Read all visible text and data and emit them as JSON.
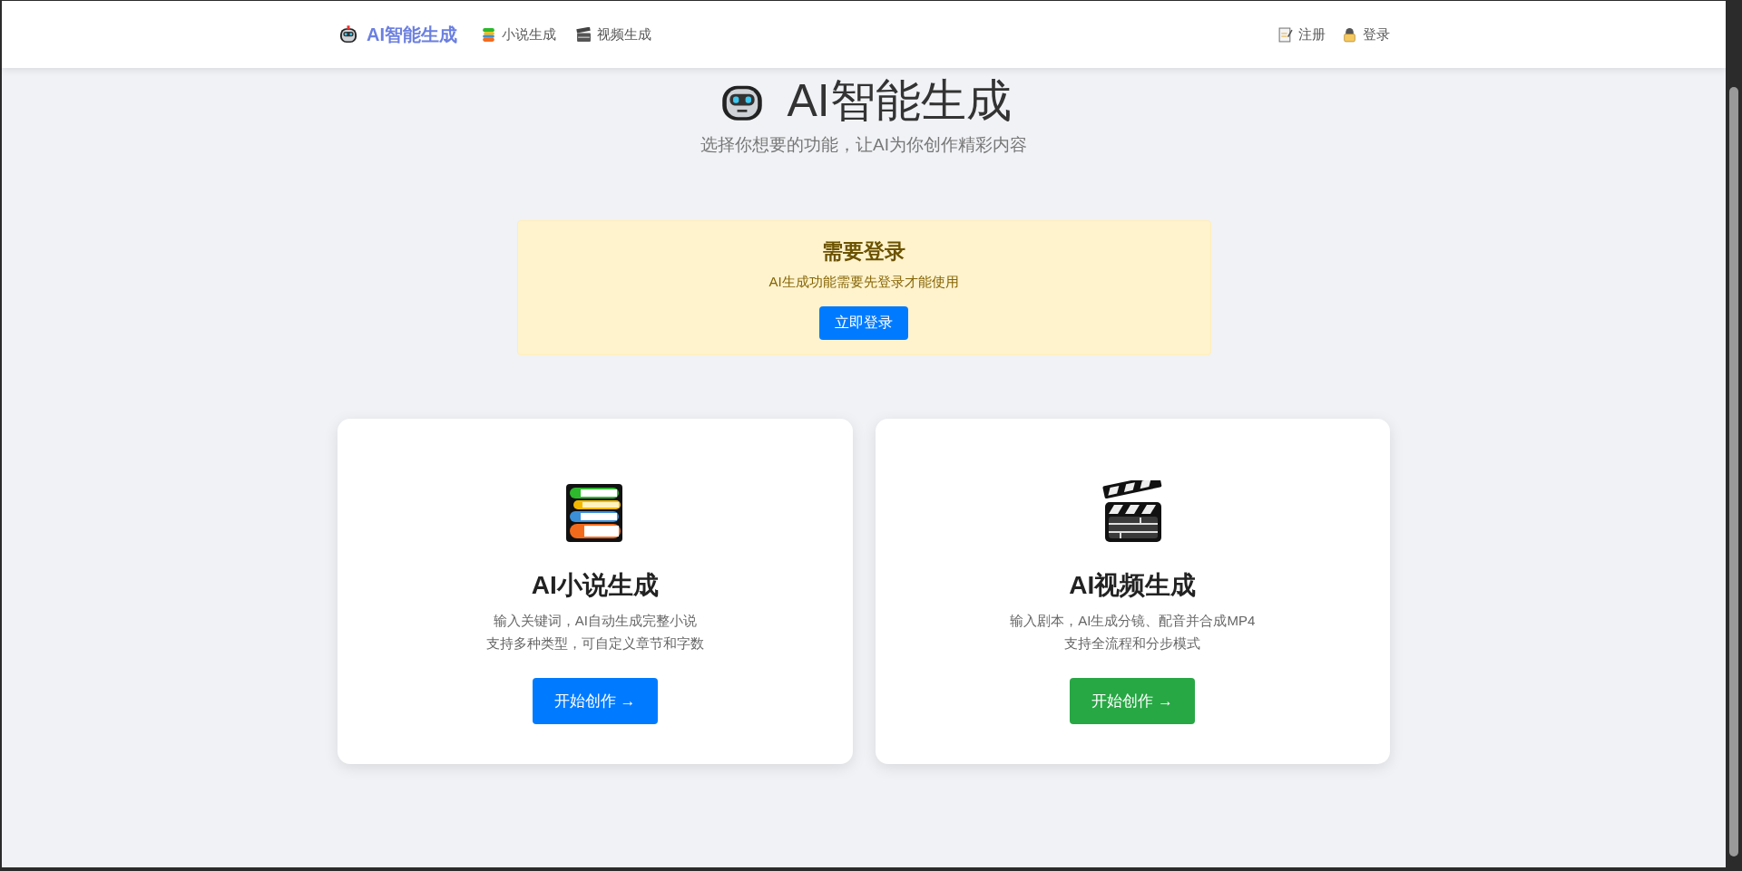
{
  "navbar": {
    "brand": "AI智能生成",
    "links": [
      {
        "kind": "novel",
        "label": "小说生成"
      },
      {
        "kind": "video",
        "label": "视频生成"
      }
    ],
    "account_links": [
      {
        "kind": "register",
        "label": "注册"
      },
      {
        "kind": "login",
        "label": "登录"
      }
    ]
  },
  "hero": {
    "title": "AI智能生成",
    "subtitle": "选择你想要的功能，让AI为你创作精彩内容"
  },
  "notice": {
    "title": "需要登录",
    "text": "AI生成功能需要先登录才能使用",
    "button": "立即登录"
  },
  "cards": [
    {
      "kind": "novel",
      "title": "AI小说生成",
      "lines": [
        "输入关键词，AI自动生成完整小说",
        "支持多种类型，可自定义章节和字数"
      ],
      "button": "开始创作 →",
      "color": "#007bff"
    },
    {
      "kind": "video",
      "title": "AI视频生成",
      "lines": [
        "输入剧本，AI生成分镜、配音并合成MP4",
        "支持全流程和分步模式"
      ],
      "button": "开始创作 →",
      "color": "#28a745"
    }
  ]
}
